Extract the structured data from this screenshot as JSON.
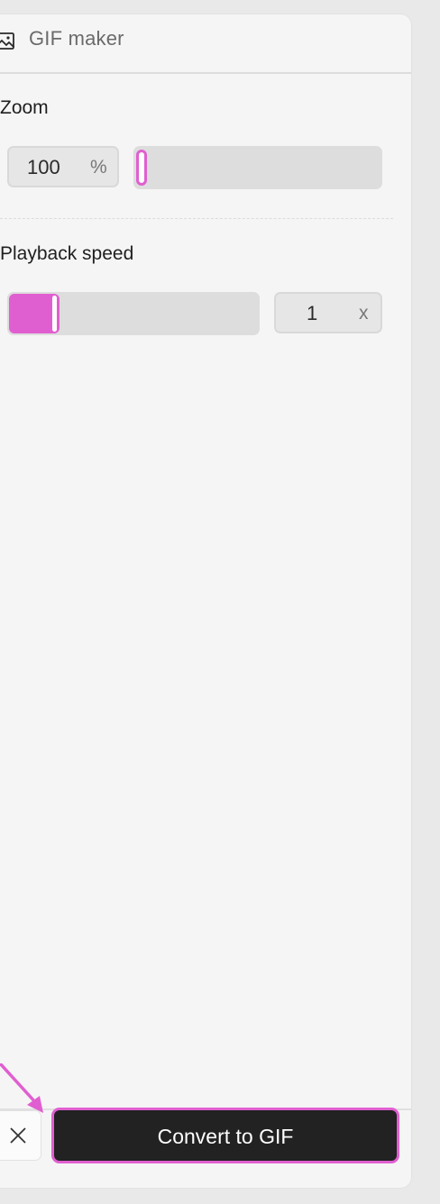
{
  "header": {
    "title": "GIF maker",
    "icon": "image-icon"
  },
  "zoom": {
    "label": "Zoom",
    "value": "100",
    "unit": "%",
    "slider_fraction": 0.02
  },
  "playback": {
    "label": "Playback speed",
    "value": "1",
    "unit": "x",
    "slider_fraction": 0.2
  },
  "footer": {
    "close_icon": "close-icon",
    "convert_label": "Convert to GIF"
  },
  "colors": {
    "accent": "#e05fd0",
    "button_bg": "#222222"
  }
}
